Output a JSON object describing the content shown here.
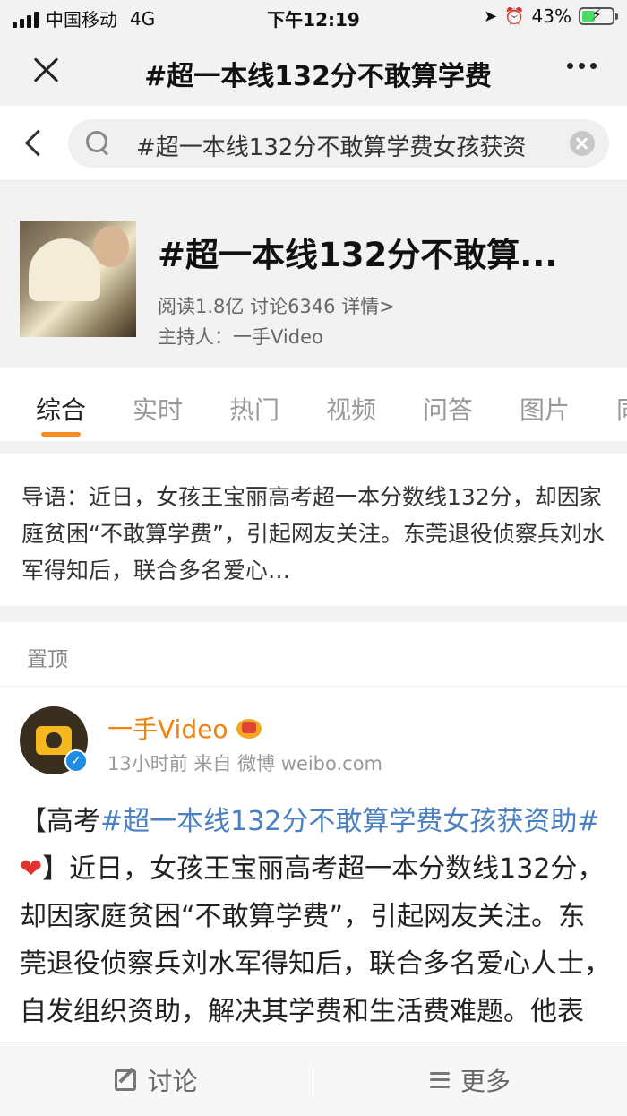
{
  "status_bar": {
    "carrier": "中国移动",
    "network": "4G",
    "time": "下午12:19",
    "battery": "43%",
    "battery_level": 0.43
  },
  "topbar": {
    "title": "#超一本线132分不敢算学费"
  },
  "search": {
    "query": "#超一本线132分不敢算学费女孩获资"
  },
  "topic": {
    "title": "#超一本线132分不敢算...",
    "stats": "阅读1.8亿 讨论6346 详情>",
    "host": "主持人：一手Video"
  },
  "tabs": [
    "综合",
    "实时",
    "热门",
    "视频",
    "问答",
    "图片",
    "同"
  ],
  "intro": {
    "text": "导语：近日，女孩王宝丽高考超一本分数线132分，却因家庭贫困“不敢算学费”，引起网友关注。东莞退役侦察兵刘水军得知后，联合多名爱心…"
  },
  "pinned": {
    "label": "置顶"
  },
  "post": {
    "author": "一手Video",
    "meta": "13小时前 来自 微博 weibo.com",
    "body_prefix": "【高考",
    "hashtag": "#超一本线132分不敢算学费女孩获资助#",
    "heart": "❤",
    "body_rest": "】近日，女孩王宝丽高考超一本分数线132分，却因家庭贫困“不敢算学费”，引起网友关注。东莞退役侦察兵刘水军得知后，联合多名爱心人士，自发组织资助，解决其学费和生活费难题。他表示，接下来他"
  },
  "bottom_bar": {
    "discuss": "讨论",
    "more": "更多"
  },
  "colors": {
    "accent": "#f68b1f",
    "author": "#f0820f",
    "hashtag": "#4a7fc1",
    "verified": "#1e8de3"
  }
}
